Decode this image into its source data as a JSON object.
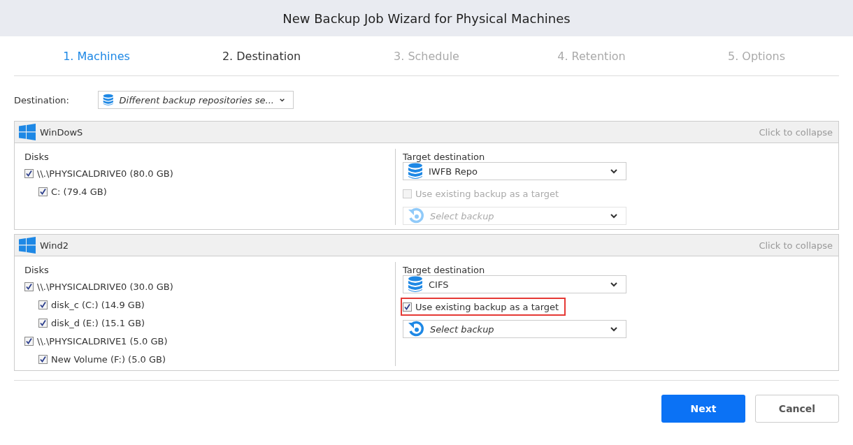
{
  "window": {
    "title": "New Backup Job Wizard for Physical Machines"
  },
  "steps": [
    {
      "label": "1. Machines",
      "selected": false,
      "completed": true
    },
    {
      "label": "2. Destination",
      "selected": true,
      "completed": false
    },
    {
      "label": "3. Schedule",
      "selected": false,
      "completed": false
    },
    {
      "label": "4. Retention",
      "selected": false,
      "completed": false
    },
    {
      "label": "5. Options",
      "selected": false,
      "completed": false
    }
  ],
  "destination": {
    "label": "Destination:",
    "value": "Different backup repositories se..."
  },
  "machines": [
    {
      "name": "WinDowS",
      "collapse_link": "Click to collapse",
      "disks_label": "Disks",
      "disks": [
        {
          "label": "\\\\.\\PHYSICALDRIVE0 (80.0 GB)",
          "checked": true,
          "children": [
            {
              "label": "C: (79.4 GB)",
              "checked": true
            }
          ]
        }
      ],
      "target_label": "Target destination",
      "target": "IWFB Repo",
      "use_existing": {
        "label": "Use existing backup as a target",
        "checked": false,
        "disabled": true,
        "highlighted": false
      },
      "backup_placeholder": "Select backup"
    },
    {
      "name": "Wind2",
      "collapse_link": "Click to collapse",
      "disks_label": "Disks",
      "disks": [
        {
          "label": "\\\\.\\PHYSICALDRIVE0 (30.0 GB)",
          "checked": true,
          "children": [
            {
              "label": "disk_c (C:) (14.9 GB)",
              "checked": true
            },
            {
              "label": "disk_d (E:) (15.1 GB)",
              "checked": true
            }
          ]
        },
        {
          "label": "\\\\.\\PHYSICALDRIVE1 (5.0 GB)",
          "checked": true,
          "children": [
            {
              "label": "New Volume (F:) (5.0 GB)",
              "checked": true
            }
          ]
        }
      ],
      "target_label": "Target destination",
      "target": "CIFS",
      "use_existing": {
        "label": "Use existing backup as a target",
        "checked": true,
        "disabled": false,
        "highlighted": true
      },
      "backup_placeholder": "Select backup"
    }
  ],
  "buttons": {
    "next": "Next",
    "cancel": "Cancel"
  }
}
